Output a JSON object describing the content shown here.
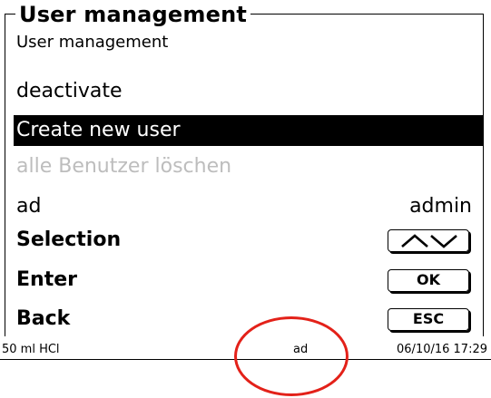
{
  "header": {
    "title": "User management",
    "subtitle": "User management"
  },
  "menu": {
    "items": [
      {
        "label": "deactivate",
        "state": "normal"
      },
      {
        "label": "Create new user",
        "state": "selected"
      },
      {
        "label": "alle Benutzer löschen",
        "state": "disabled"
      }
    ]
  },
  "current_user": {
    "label": "ad",
    "value": "admin"
  },
  "softkeys": {
    "selection": {
      "label": "Selection",
      "key_icon": "up-down-arrows-icon"
    },
    "enter": {
      "label": "Enter",
      "key_label": "OK"
    },
    "back": {
      "label": "Back",
      "key_label": "ESC"
    }
  },
  "status_bar": {
    "left": "50 ml HCl",
    "center": "ad",
    "right": "06/10/16 17:29"
  },
  "colors": {
    "selected_bg": "#000000",
    "selected_fg": "#ffffff",
    "disabled_text": "#bdbdbd",
    "annotation": "#e32119"
  }
}
